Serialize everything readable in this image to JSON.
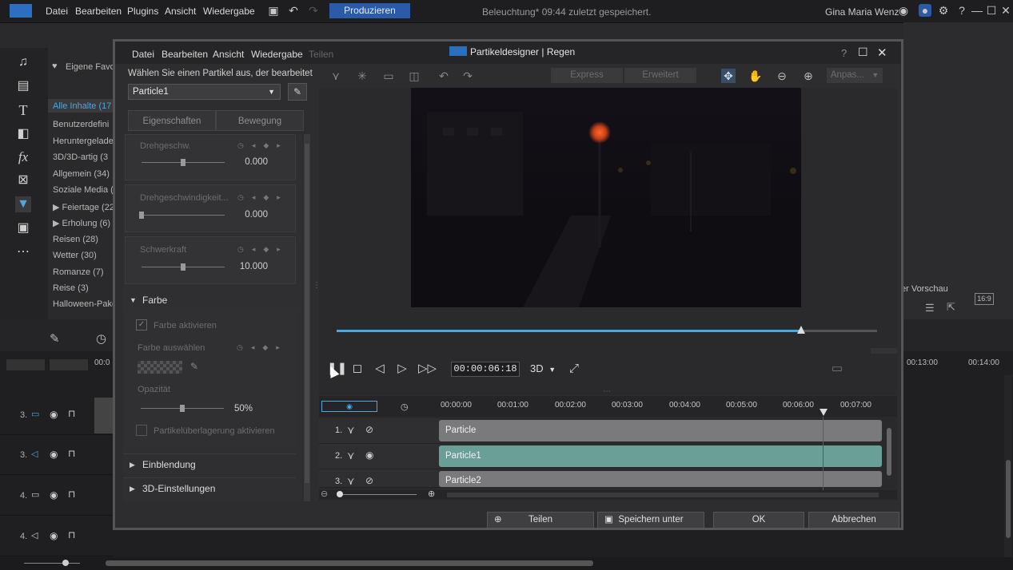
{
  "app": {
    "menu": [
      "Datei",
      "Bearbeiten",
      "Plugins",
      "Ansicht",
      "Wiedergabe"
    ],
    "produce_label": "Produzieren",
    "status": "Beleuchtung* 09:44 zuletzt gespeichert.",
    "user": "Gina Maria Wenz",
    "accent_color": "#2a5aa8"
  },
  "library": {
    "favorites_label": "Eigene Favo",
    "items": [
      "Alle Inhalte (17",
      "Benutzerdefini",
      "Heruntergelade",
      "3D/3D-artig (3",
      "Allgemein (34)",
      "Soziale Media (",
      "▶ Feiertage (22",
      "▶ Erholung (6)",
      "Reisen (28)",
      "Wetter (30)",
      "Romanze (7)",
      "Reise (3)",
      "Halloween-Pake"
    ]
  },
  "bg_timeline": {
    "tracks": [
      "3.",
      "3.",
      "4.",
      "4."
    ],
    "ruler_right": [
      "00:13:00",
      "00:14:00"
    ],
    "ruler_left": "00:0",
    "right_label": "er Vorschau",
    "aspect": "16:9"
  },
  "dialog": {
    "menu": [
      "Datei",
      "Bearbeiten",
      "Ansicht",
      "Wiedergabe",
      "Teilen"
    ],
    "title": "Partikeldesigner  |  Regen",
    "help": "?",
    "select_label": "Wählen Sie einen Partikel aus, der bearbeitet",
    "selected_particle": "Particle1",
    "tabs": [
      "Eigenschaften",
      "Bewegung"
    ],
    "properties": [
      {
        "label": "Drehgeschw.",
        "value": "0.000",
        "level": 0.5
      },
      {
        "label": "Drehgeschwindigkeit...",
        "value": "0.000",
        "level": 0.0
      },
      {
        "label": "Schwerkraft",
        "value": "10.000",
        "level": 0.5
      }
    ],
    "farbe_section": "Farbe",
    "enable_color": "Farbe aktivieren",
    "choose_color": "Farbe auswählen",
    "opacity_label": "Opazität",
    "opacity_value": "50%",
    "opacity_level": 0.5,
    "overlay_label": "Partikelüberlagerung aktivieren",
    "sections": [
      "Einblendung",
      "3D-Einstellungen"
    ],
    "modes": [
      "Express",
      "Erweitert"
    ],
    "fit_label": "Anpas...",
    "timecode": "00:00:06:18",
    "mode_3d": "3D",
    "playback_progress": 0.86,
    "ruler": [
      "00:00:00",
      "00:01:00",
      "00:02:00",
      "00:03:00",
      "00:04:00",
      "00:05:00",
      "00:06:00",
      "00:07:00"
    ],
    "rows": [
      {
        "num": "1.",
        "clip": "Particle",
        "color": "#7a7a7c"
      },
      {
        "num": "2.",
        "clip": "Particle1",
        "color": "#6a9f98"
      },
      {
        "num": "3.",
        "clip": "Particle2",
        "color": "#7a7a7c"
      }
    ],
    "buttons": {
      "share": "Teilen",
      "save_as": "Speichern unter",
      "ok": "OK",
      "cancel": "Abbrechen"
    }
  }
}
